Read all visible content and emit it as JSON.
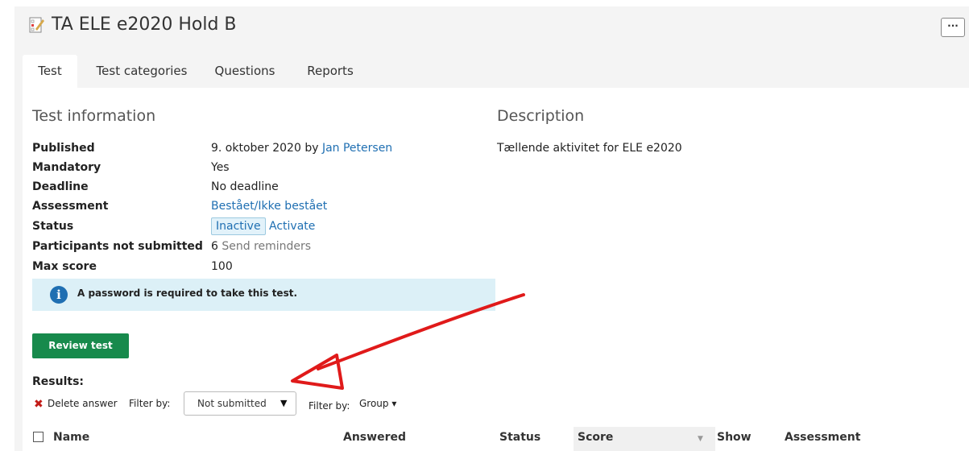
{
  "header": {
    "title": "TA ELE e2020 Hold B",
    "more_label": "···"
  },
  "tabs": [
    {
      "label": "Test",
      "active": true
    },
    {
      "label": "Test categories",
      "active": false
    },
    {
      "label": "Questions",
      "active": false
    },
    {
      "label": "Reports",
      "active": false
    }
  ],
  "test_info": {
    "heading": "Test information",
    "published_label": "Published",
    "published_value": "9. oktober 2020 by ",
    "published_author": "Jan Petersen",
    "mandatory_label": "Mandatory",
    "mandatory_value": "Yes",
    "deadline_label": "Deadline",
    "deadline_value": "No deadline",
    "assessment_label": "Assessment",
    "assessment_value": "Bestået/Ikke bestået",
    "status_label": "Status",
    "status_value": "Inactive",
    "status_action": "Activate",
    "participants_label": "Participants not submitted",
    "participants_count": "6",
    "participants_action": "Send reminders",
    "maxscore_label": "Max score",
    "maxscore_value": "100"
  },
  "alert": {
    "icon": "info-icon",
    "text": "A password is required to take this test."
  },
  "description": {
    "heading": "Description",
    "text": "Tællende aktivitet for ELE e2020"
  },
  "actions": {
    "review_label": "Review test"
  },
  "results": {
    "label": "Results:",
    "delete_label": "Delete answer",
    "filter_label_1": "Filter by:",
    "filter_value": "Not submitted",
    "filter_label_2": "Filter by:",
    "group_label": "Group ▾"
  },
  "table": {
    "columns": [
      "Name",
      "Answered",
      "Status",
      "Score",
      "Show",
      "Assessment"
    ]
  },
  "colors": {
    "accent": "#1f6fb2",
    "primary_button": "#178a4c",
    "annotation_arrow": "#e01a1a"
  }
}
